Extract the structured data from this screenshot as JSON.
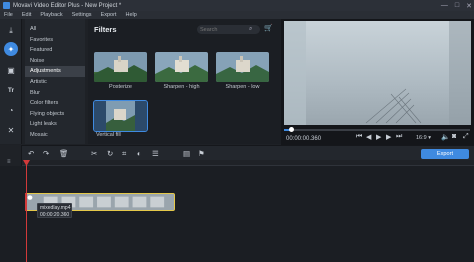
{
  "window": {
    "title": "Movavi Video Editor Plus - New Project *",
    "controls": [
      "—",
      "□",
      "✕"
    ]
  },
  "menu": [
    "File",
    "Edit",
    "Playback",
    "Settings",
    "Export",
    "Help"
  ],
  "toolstrip": [
    {
      "icon": "import-icon",
      "glyph": "⤓"
    },
    {
      "icon": "filters-icon",
      "glyph": "✦"
    },
    {
      "icon": "transitions-icon",
      "glyph": "▣"
    },
    {
      "icon": "titles-icon",
      "glyph": "Tr"
    },
    {
      "icon": "stickers-icon",
      "glyph": "◔"
    },
    {
      "icon": "more-tools-icon",
      "glyph": "✕"
    }
  ],
  "categories": [
    "All",
    "Favorites",
    "Featured",
    "Noise",
    "Adjustments",
    "Artistic",
    "Blur",
    "Color filters",
    "Flying objects",
    "Light leaks",
    "Mosaic"
  ],
  "selected_category": "Adjustments",
  "filters_panel": {
    "heading": "Filters",
    "search_placeholder": "Search",
    "items": [
      {
        "label": "Posterize"
      },
      {
        "label": "Sharpen - high"
      },
      {
        "label": "Sharpen - low"
      },
      {
        "label": "Vertical fill"
      }
    ]
  },
  "player": {
    "timecode": "00:00:00.360",
    "aspect_ratio": "16:9 ▾"
  },
  "timeline_toolbar": {
    "export_label": "Export"
  },
  "clip": {
    "filename": "mixedlay.mp4",
    "time": "00:00:20.360"
  },
  "colors": {
    "accent": "#3f8ae0",
    "playhead": "#d23a3a",
    "clip_border": "#e4c84a"
  }
}
